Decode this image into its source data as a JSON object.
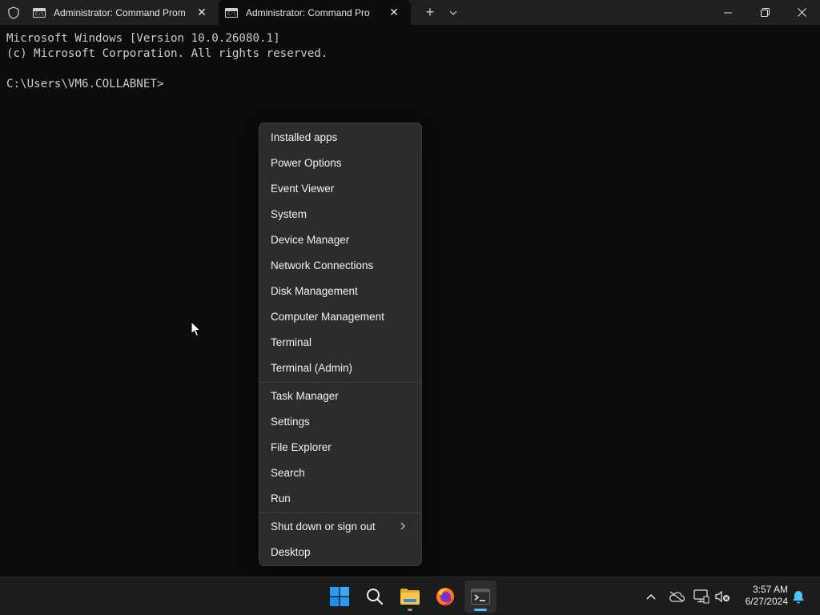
{
  "tabs": [
    {
      "title": "Administrator: Command Prom",
      "icon": "cmd-icon",
      "icon_text": "C:\\.",
      "active": false
    },
    {
      "title": "Administrator: Command Pro",
      "icon": "cmd-icon",
      "icon_text": "C:\\.",
      "active": true
    }
  ],
  "titlebar": {
    "new_tab": "+",
    "close_glyph": "✕"
  },
  "console": {
    "line1": "Microsoft Windows [Version 10.0.26080.1]",
    "line2": "(c) Microsoft Corporation. All rights reserved.",
    "line3": "",
    "prompt": "C:\\Users\\VM6.COLLABNET>"
  },
  "menu": {
    "items": [
      {
        "label": "Installed apps"
      },
      {
        "label": "Power Options"
      },
      {
        "label": "Event Viewer"
      },
      {
        "label": "System"
      },
      {
        "label": "Device Manager"
      },
      {
        "label": "Network Connections"
      },
      {
        "label": "Disk Management"
      },
      {
        "label": "Computer Management"
      },
      {
        "label": "Terminal"
      },
      {
        "label": "Terminal (Admin)"
      },
      {
        "label": "Task Manager"
      },
      {
        "label": "Settings"
      },
      {
        "label": "File Explorer"
      },
      {
        "label": "Search"
      },
      {
        "label": "Run"
      },
      {
        "label": "Shut down or sign out",
        "has_submenu": true
      },
      {
        "label": "Desktop"
      }
    ]
  },
  "taskbar": {
    "apps": [
      {
        "name": "start-button",
        "icon": "windows-logo-icon"
      },
      {
        "name": "search-button",
        "icon": "search-icon"
      },
      {
        "name": "file-explorer-button",
        "icon": "folder-icon",
        "running": true
      },
      {
        "name": "firefox-button",
        "icon": "firefox-icon"
      },
      {
        "name": "terminal-button",
        "icon": "terminal-icon",
        "running": true,
        "active": true
      }
    ],
    "tray": [
      "chevron-up-icon",
      "onedrive-offline-icon",
      "network-icon",
      "volume-muted-icon"
    ],
    "time": "3:57 AM",
    "date": "6/27/2024"
  },
  "colors": {
    "accent": "#4cc2ff",
    "console_bg": "#0c0c0c",
    "titlebar_bg": "#202020",
    "menu_bg": "#2c2c2c",
    "taskbar_bg": "#1c1c1c"
  }
}
